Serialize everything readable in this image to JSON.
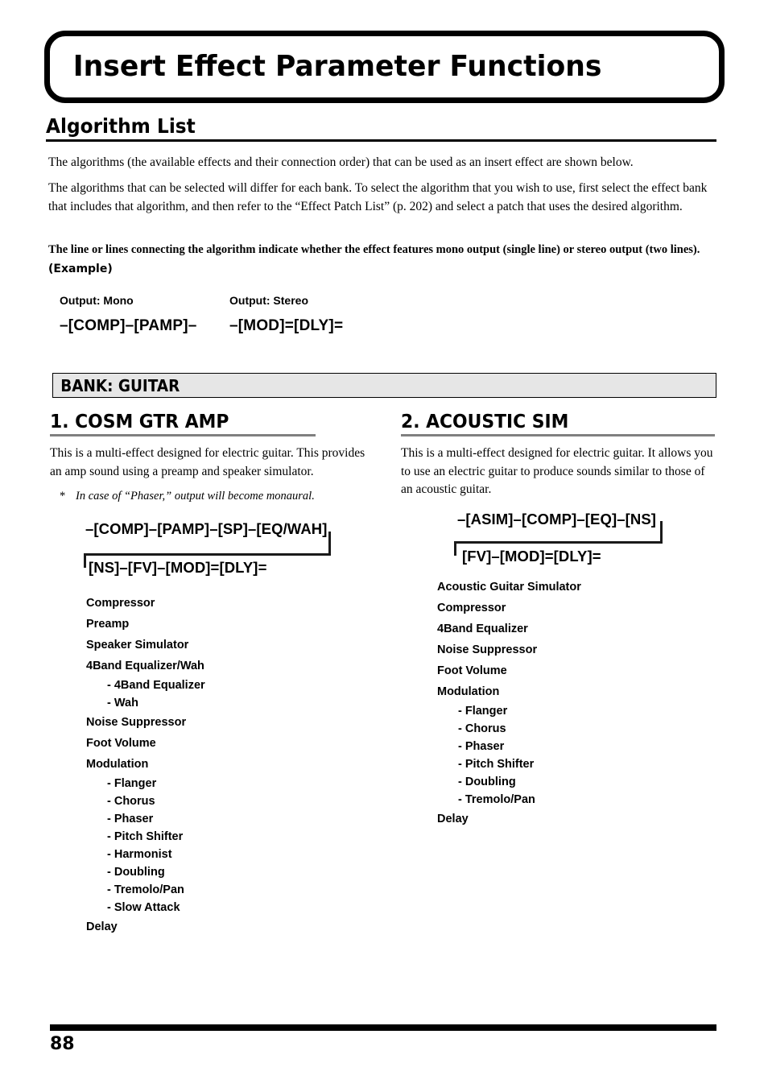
{
  "document": {
    "title": "Insert Effect Parameter Functions",
    "page_number": "88"
  },
  "algorithm_list": {
    "heading": "Algorithm List",
    "paragraph_1": "The algorithms (the available effects and their connection order) that can be used as an insert effect are shown below.",
    "paragraph_2": "The algorithms that can be selected will differ for each bank. To select the algorithm that you wish to use, first select the effect bank that includes that algorithm, and then refer to the “Effect Patch List” (p. 202) and select a patch that uses the desired algorithm.",
    "bold_note": "The line or lines connecting the algorithm indicate whether the effect features mono output (single line) or stereo output (two lines).",
    "example_label": "(Example)",
    "example_mono": {
      "label": "Output: Mono",
      "chain": "–[COMP]–[PAMP]–"
    },
    "example_stereo": {
      "label": "Output: Stereo",
      "chain": "–[MOD]=[DLY]="
    }
  },
  "bank": {
    "title": "BANK: GUITAR"
  },
  "sections": [
    {
      "heading": "1. COSM GTR AMP",
      "body": "This is a multi-effect designed for electric guitar. This provides an amp sound using a preamp and speaker simulator.",
      "note_star": "*",
      "note": "In case of “Phaser,” output will become monaural.",
      "diagram_row_1": "–[COMP]–[PAMP]–[SP]–[EQ/WAH]",
      "diagram_row_2": "[NS]–[FV]–[MOD]=[DLY]=",
      "params": [
        {
          "label": "Compressor",
          "sub": []
        },
        {
          "label": "Preamp",
          "sub": []
        },
        {
          "label": "Speaker Simulator",
          "sub": []
        },
        {
          "label": "4Band Equalizer/Wah",
          "sub": [
            "- 4Band Equalizer",
            "- Wah"
          ]
        },
        {
          "label": "Noise Suppressor",
          "sub": []
        },
        {
          "label": "Foot Volume",
          "sub": []
        },
        {
          "label": "Modulation",
          "sub": [
            "- Flanger",
            "- Chorus",
            "- Phaser",
            "- Pitch Shifter",
            "- Harmonist",
            "- Doubling",
            "- Tremolo/Pan",
            "- Slow Attack"
          ]
        },
        {
          "label": "Delay",
          "sub": []
        }
      ]
    },
    {
      "heading": "2. ACOUSTIC SIM",
      "body": "This is a multi-effect designed for electric guitar. It allows you to use an electric guitar to produce sounds similar to those of an acoustic guitar.",
      "note_star": "",
      "note": "",
      "diagram_row_1": "–[ASIM]–[COMP]–[EQ]–[NS]",
      "diagram_row_2": "[FV]–[MOD]=[DLY]=",
      "params": [
        {
          "label": "Acoustic Guitar Simulator",
          "sub": []
        },
        {
          "label": "Compressor",
          "sub": []
        },
        {
          "label": "4Band Equalizer",
          "sub": []
        },
        {
          "label": "Noise Suppressor",
          "sub": []
        },
        {
          "label": "Foot Volume",
          "sub": []
        },
        {
          "label": "Modulation",
          "sub": [
            "- Flanger",
            "- Chorus",
            "- Phaser",
            "- Pitch Shifter",
            "- Doubling",
            "- Tremolo/Pan"
          ]
        },
        {
          "label": "Delay",
          "sub": []
        }
      ]
    }
  ],
  "colors": {
    "bank_bar_fill": "#e6e6e6",
    "section_rule": "#808080",
    "text": "#000000"
  }
}
